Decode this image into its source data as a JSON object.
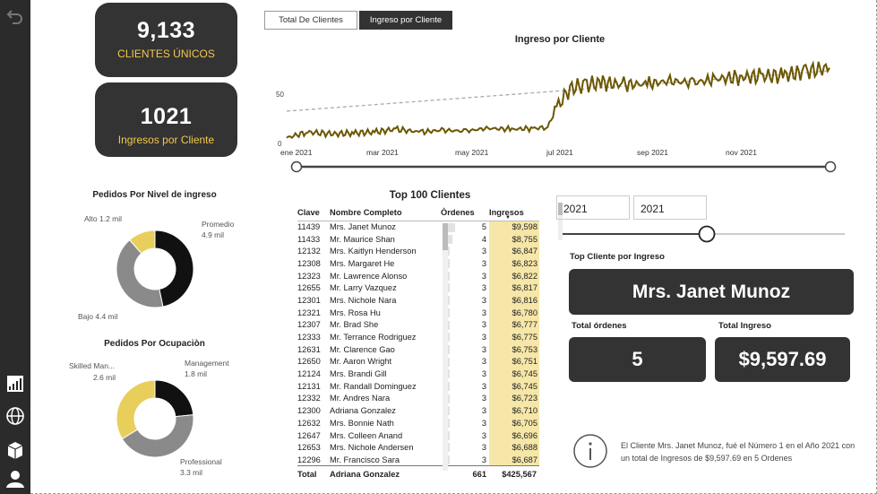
{
  "kpi": {
    "clientes_value": "9,133",
    "clientes_label": "CLIENTES ÚNICOS",
    "ingresos_value": "1021",
    "ingresos_label": "Ingresos por Cliente"
  },
  "tabs": [
    {
      "label": "Total De Clientes",
      "active": false
    },
    {
      "label": "Ingreso por Cliente",
      "active": true
    }
  ],
  "line_chart": {
    "title": "Ingreso por Cliente",
    "y_ticks": [
      "50",
      "0"
    ],
    "x_ticks": [
      "ene 2021",
      "mar 2021",
      "may 2021",
      "jul 2021",
      "sep 2021",
      "nov 2021"
    ],
    "line_color": "#6b5700",
    "trend_color": "#aaaaaa"
  },
  "chart_data": [
    {
      "type": "line",
      "title": "Ingreso por Cliente",
      "x_range": [
        "2021-01-01",
        "2021-12-31"
      ],
      "ylim": [
        0,
        90
      ],
      "x_tick_labels": [
        "ene 2021",
        "mar 2021",
        "may 2021",
        "jul 2021",
        "sep 2021",
        "nov 2021"
      ],
      "y_tick_labels": [
        "0",
        "50"
      ],
      "series": [
        {
          "x": [
            "2021-01-01",
            "2021-01-15",
            "2021-02-01",
            "2021-02-15",
            "2021-03-01",
            "2021-03-15",
            "2021-04-01",
            "2021-04-15",
            "2021-05-01",
            "2021-05-15",
            "2021-06-01",
            "2021-06-15",
            "2021-06-25",
            "2021-07-01",
            "2021-07-10",
            "2021-07-20",
            "2021-08-01",
            "2021-08-15",
            "2021-09-01",
            "2021-09-15",
            "2021-10-01",
            "2021-10-15",
            "2021-11-01",
            "2021-11-15",
            "2021-12-01",
            "2021-12-15",
            "2021-12-31"
          ],
          "y": [
            6,
            12,
            10,
            11,
            12,
            15,
            12,
            14,
            13,
            16,
            15,
            16,
            17,
            38,
            58,
            62,
            64,
            62,
            63,
            66,
            64,
            68,
            70,
            71,
            72,
            76,
            80
          ]
        }
      ]
    },
    {
      "type": "pie",
      "title": "Pedidos Por Nivel de ingreso",
      "labels": [
        "Promedio",
        "Bajo",
        "Alto"
      ],
      "values": [
        4.9,
        4.4,
        1.2
      ],
      "value_labels": [
        "4.9 mil",
        "4.4 mil",
        "1.2 mil"
      ]
    },
    {
      "type": "pie",
      "title": "Pedidos Por Ocupaciòn",
      "labels": [
        "Management",
        "Professional",
        "Skilled Man..."
      ],
      "values": [
        1.8,
        3.3,
        2.6
      ],
      "value_labels": [
        "1.8 mil",
        "3.3 mil",
        "2.6 mil"
      ]
    }
  ],
  "donut1": {
    "title": "Pedidos Por Nivel de ingreso",
    "alto": "Alto 1.2 mil",
    "promedio": "Promedio",
    "promedio_val": "4.9 mil",
    "bajo": "Bajo 4.4 mil"
  },
  "donut2": {
    "title": "Pedidos Por Ocupaciòn",
    "skilled": "Skilled Man...",
    "skilled_val": "2.6 mil",
    "management": "Management",
    "management_val": "1.8 mil",
    "professional": "Professional",
    "professional_val": "3.3 mil"
  },
  "table": {
    "title": "Top 100 Clientes",
    "headers": {
      "clave": "Clave",
      "nombre": "Nombre Completo",
      "ordenes": "Òrdenes",
      "ingresos": "Ingresos"
    },
    "rows": [
      [
        "11439",
        "Mrs. Janet Munoz",
        "5",
        "$9,598"
      ],
      [
        "11433",
        "Mr. Maurice Shan",
        "4",
        "$8,755"
      ],
      [
        "12132",
        "Mrs. Kaitlyn Henderson",
        "3",
        "$6,847"
      ],
      [
        "12308",
        "Mrs. Margaret He",
        "3",
        "$6,823"
      ],
      [
        "12323",
        "Mr. Lawrence Alonso",
        "3",
        "$6,822"
      ],
      [
        "12655",
        "Mr. Larry Vazquez",
        "3",
        "$6,817"
      ],
      [
        "12301",
        "Mrs. Nichole Nara",
        "3",
        "$6,816"
      ],
      [
        "12321",
        "Mrs. Rosa Hu",
        "3",
        "$6,780"
      ],
      [
        "12307",
        "Mr. Brad She",
        "3",
        "$6,777"
      ],
      [
        "12333",
        "Mr. Terrance Rodriguez",
        "3",
        "$6,775"
      ],
      [
        "12631",
        "Mr. Clarence Gao",
        "3",
        "$6,753"
      ],
      [
        "12650",
        "Mr. Aaron Wright",
        "3",
        "$6,751"
      ],
      [
        "12124",
        "Mrs. Brandi Gill",
        "3",
        "$6,745"
      ],
      [
        "12131",
        "Mr. Randall Dominguez",
        "3",
        "$6,745"
      ],
      [
        "12332",
        "Mr. Andres Nara",
        "3",
        "$6,723"
      ],
      [
        "12300",
        "Adriana Gonzalez",
        "3",
        "$6,710"
      ],
      [
        "12632",
        "Mrs. Bonnie Nath",
        "3",
        "$6,705"
      ],
      [
        "12647",
        "Mrs. Colleen Anand",
        "3",
        "$6,696"
      ],
      [
        "12653",
        "Mrs. Nichole Andersen",
        "3",
        "$6,688"
      ],
      [
        "12296",
        "Mr. Francisco Sara",
        "3",
        "$6,687"
      ]
    ],
    "total": {
      "label": "Total",
      "nombre": "Adriana Gonzalez",
      "ordenes": "661",
      "ingresos": "$425,567"
    }
  },
  "slicer": {
    "from": "2021",
    "to": "2021"
  },
  "top_cliente": {
    "label": "Top Cliente por Ingreso",
    "name": "Mrs. Janet Munoz",
    "ordenes_label": "Total órdenes",
    "ordenes_value": "5",
    "ingreso_label": "Total Ingreso",
    "ingreso_value": "$9,597.69"
  },
  "info_text": "El Cliente Mrs. Janet Munoz, fué el Número 1 en el Año 2021 con un total de Ingresos de $9,597.69 en 5 Ordenes",
  "colors": {
    "dark": "#333333",
    "gold": "#f2c94c",
    "yellow": "#e8cf5c",
    "gray": "#8a8a8a",
    "black": "#111111"
  },
  "icons": [
    "back-arrow-icon",
    "chart-icon",
    "globe-icon",
    "box-icon",
    "user-icon",
    "info-icon"
  ]
}
